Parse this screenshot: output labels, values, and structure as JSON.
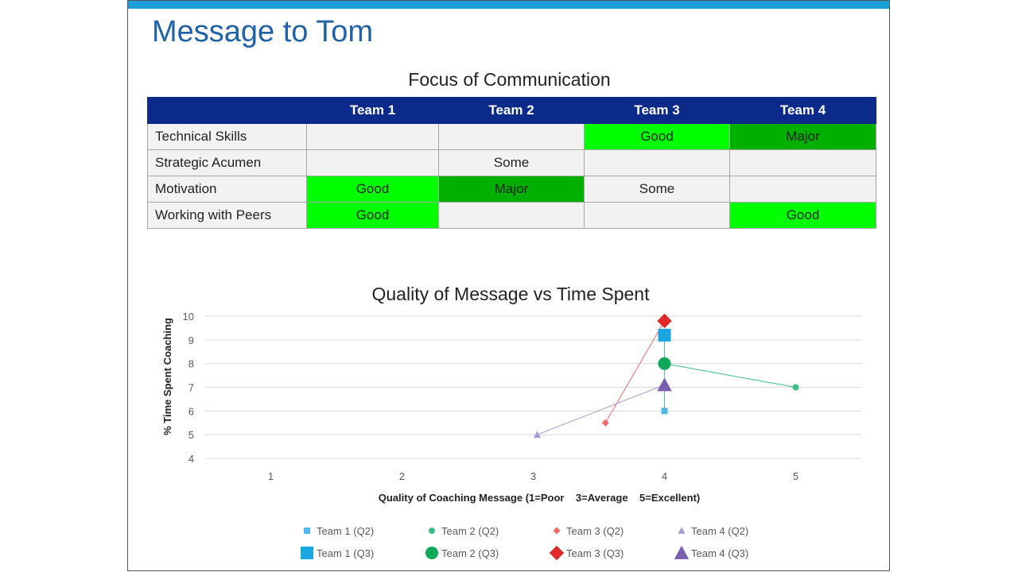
{
  "page": {
    "title": "Message to Tom",
    "colors": {
      "accent_bar": "#1a9fd8",
      "title": "#1f62a8",
      "table_header": "#0b2a8a",
      "good": "#00ff00",
      "major": "#00b000",
      "cell": "#f2f2f2"
    }
  },
  "table": {
    "title": "Focus of Communication",
    "columns": [
      "",
      "Team 1",
      "Team 2",
      "Team 3",
      "Team 4"
    ],
    "rows": [
      {
        "label": "Technical Skills",
        "cells": [
          "",
          "",
          "Good",
          "Major"
        ]
      },
      {
        "label": "Strategic Acumen",
        "cells": [
          "",
          "Some",
          "",
          ""
        ]
      },
      {
        "label": "Motivation",
        "cells": [
          "Good",
          "Major",
          "Some",
          ""
        ]
      },
      {
        "label": "Working with Peers",
        "cells": [
          "Good",
          "",
          "",
          "Good"
        ]
      }
    ]
  },
  "chart_data": {
    "type": "scatter",
    "title": "Quality of Message vs Time Spent",
    "xlabel": "Quality of Coaching Message (1=Poor    3=Average    5=Excellent)",
    "ylabel": "% Time Spent Coaching",
    "xlim": [
      0.5,
      5.5
    ],
    "ylim": [
      4,
      10
    ],
    "xticks": [
      1,
      2,
      3,
      4,
      5
    ],
    "yticks": [
      4,
      5,
      6,
      7,
      8,
      9,
      10
    ],
    "grid": "horizontal",
    "legend": "bottom",
    "series": [
      {
        "name": "Team 1 (Q2)",
        "color": "#4fb8e6",
        "marker": "square",
        "size": "small",
        "x": [
          4.0
        ],
        "y": [
          6.0
        ]
      },
      {
        "name": "Team 2 (Q2)",
        "color": "#3cbd84",
        "marker": "circle",
        "size": "small",
        "x": [
          5.0
        ],
        "y": [
          7.0
        ]
      },
      {
        "name": "Team 3 (Q2)",
        "color": "#ee6b6b",
        "marker": "diamond",
        "size": "small",
        "x": [
          3.55
        ],
        "y": [
          5.5
        ]
      },
      {
        "name": "Team 4 (Q2)",
        "color": "#a99ad4",
        "marker": "triangle",
        "size": "small",
        "x": [
          3.03
        ],
        "y": [
          5.0
        ]
      },
      {
        "name": "Team 1 (Q3)",
        "color": "#1aa7df",
        "marker": "square",
        "size": "large",
        "x": [
          4.0
        ],
        "y": [
          9.2
        ]
      },
      {
        "name": "Team 2 (Q3)",
        "color": "#0fa858",
        "marker": "circle",
        "size": "large",
        "x": [
          4.0
        ],
        "y": [
          8.0
        ]
      },
      {
        "name": "Team 3 (Q3)",
        "color": "#e02a2a",
        "marker": "diamond",
        "size": "large",
        "x": [
          4.0
        ],
        "y": [
          9.8
        ]
      },
      {
        "name": "Team 4 (Q3)",
        "color": "#7a5fb0",
        "marker": "triangle",
        "size": "large",
        "x": [
          4.0
        ],
        "y": [
          7.1
        ]
      }
    ],
    "connectors": [
      {
        "from": "Team 1 (Q2)",
        "to": "Team 1 (Q3)"
      },
      {
        "from": "Team 2 (Q2)",
        "to": "Team 2 (Q3)"
      },
      {
        "from": "Team 3 (Q2)",
        "to": "Team 3 (Q3)"
      },
      {
        "from": "Team 4 (Q2)",
        "to": "Team 4 (Q3)"
      }
    ]
  }
}
